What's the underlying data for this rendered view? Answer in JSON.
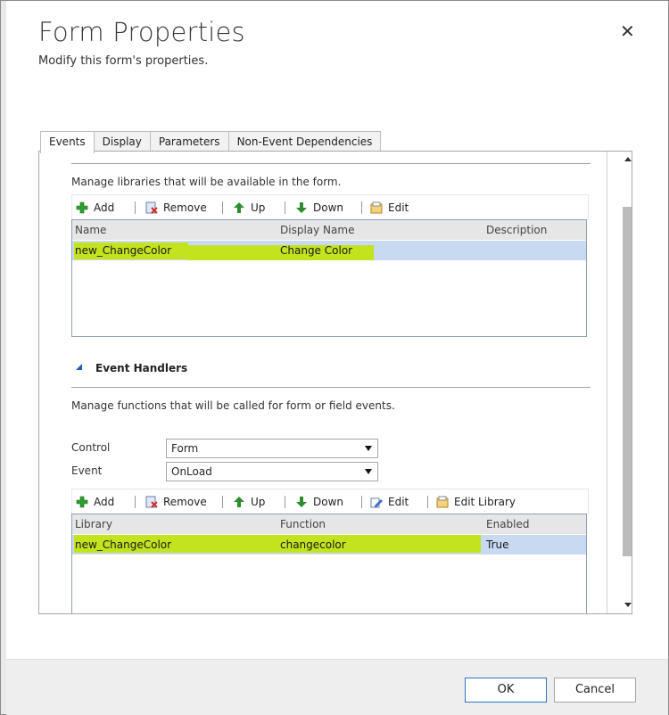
{
  "dialog": {
    "title": "Form Properties",
    "subtitle": "Modify this form's properties.",
    "close_glyph": "✕"
  },
  "tabs": [
    {
      "label": "Events",
      "active": true
    },
    {
      "label": "Display",
      "active": false
    },
    {
      "label": "Parameters",
      "active": false
    },
    {
      "label": "Non-Event Dependencies",
      "active": false
    }
  ],
  "libraries": {
    "description": "Manage libraries that will be available in the form.",
    "toolbar": {
      "add": "Add",
      "remove": "Remove",
      "up": "Up",
      "down": "Down",
      "edit": "Edit"
    },
    "columns": [
      "Name",
      "Display Name",
      "Description"
    ],
    "rows": [
      {
        "name": "new_ChangeColor",
        "display_name": "Change Color",
        "description": ""
      }
    ]
  },
  "event_handlers": {
    "section_title": "Event Handlers",
    "description": "Manage functions that will be called for form or field events.",
    "control_label": "Control",
    "control_value": "Form",
    "event_label": "Event",
    "event_value": "OnLoad",
    "toolbar": {
      "add": "Add",
      "remove": "Remove",
      "up": "Up",
      "down": "Down",
      "edit": "Edit",
      "edit_library": "Edit Library"
    },
    "columns": [
      "Library",
      "Function",
      "Enabled"
    ],
    "rows": [
      {
        "library": "new_ChangeColor",
        "function": "changecolor",
        "enabled": "True"
      }
    ]
  },
  "footer": {
    "ok": "OK",
    "cancel": "Cancel"
  },
  "colors": {
    "highlight": "#c3e412",
    "row_selected": "#c8d9f2",
    "ok_border": "#2f73c6",
    "add_icon": "#2e9e2e",
    "arrow_icon": "#2e8b2e"
  }
}
